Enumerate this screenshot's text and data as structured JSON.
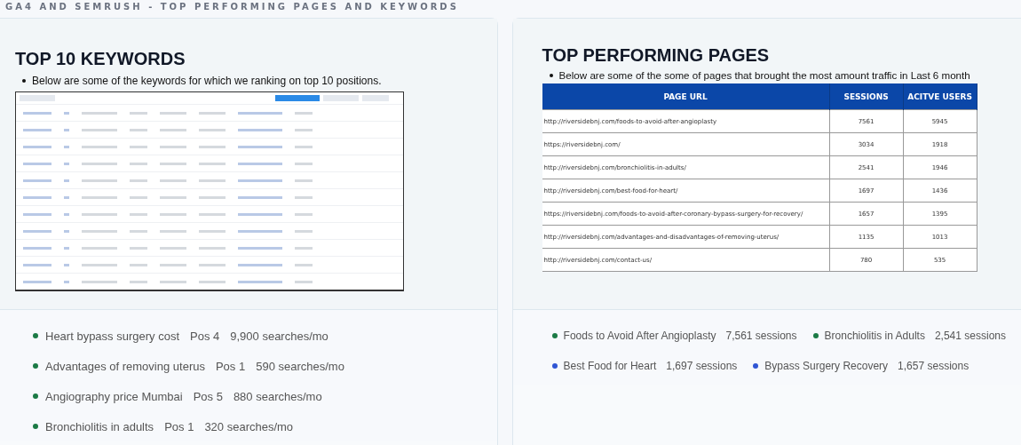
{
  "section_title": "GA4 AND SEMRUSH - TOP PERFORMING PAGES AND KEYWORDS",
  "keywords_card": {
    "title": "TOP 10 KEYWORDS",
    "note": "Below are some of the keywords for which we ranking on top 10 positions.",
    "highlights": [
      {
        "name": "Heart bypass surgery cost",
        "position": "Pos 4",
        "volume": "9,900 searches/mo",
        "color": "#1b7a45"
      },
      {
        "name": "Advantages of removing uterus",
        "position": "Pos 1",
        "volume": "590 searches/mo",
        "color": "#1b7a45"
      },
      {
        "name": "Angiography price Mumbai",
        "position": "Pos 5",
        "volume": "880 searches/mo",
        "color": "#1b7a45"
      },
      {
        "name": "Bronchiolitis in adults",
        "position": "Pos 1",
        "volume": "320 searches/mo",
        "color": "#1b7a45"
      }
    ]
  },
  "pages_card": {
    "title": "TOP PERFORMING PAGES",
    "note": "Below are some of the some of pages that brought the most amount traffic in Last 6 month",
    "table": {
      "columns": [
        "PAGE URL",
        "SESSIONS",
        "ACITVE USERS"
      ],
      "rows": [
        [
          "http://riversidebnj.com/foods-to-avoid-after-angioplasty",
          "7561",
          "5945"
        ],
        [
          "https://riversidebnj.com/",
          "3034",
          "1918"
        ],
        [
          "http://riversidebnj.com/bronchiolitis-in-adults/",
          "2541",
          "1946"
        ],
        [
          "http://riversidebnj.com/best-food-for-heart/",
          "1697",
          "1436"
        ],
        [
          "https://riversidebnj.com/foods-to-avoid-after-coronary-bypass-surgery-for-recovery/",
          "1657",
          "1395"
        ],
        [
          "http://riversidebnj.com/advantages-and-disadvantages-of-removing-uterus/",
          "1135",
          "1013"
        ],
        [
          "http://riversidebnj.com/contact-us/",
          "780",
          "535"
        ]
      ]
    },
    "highlights": [
      {
        "name": "Foods to Avoid After Angioplasty",
        "sessions": "7,561 sessions",
        "color": "#1b7a45"
      },
      {
        "name": "Bronchiolitis in Adults",
        "sessions": "2,541 sessions",
        "color": "#1b7a45"
      },
      {
        "name": "Best Food for Heart",
        "sessions": "1,697 sessions",
        "color": "#2f55d4"
      },
      {
        "name": "Bypass Surgery Recovery",
        "sessions": "1,657 sessions",
        "color": "#2f55d4"
      }
    ]
  }
}
